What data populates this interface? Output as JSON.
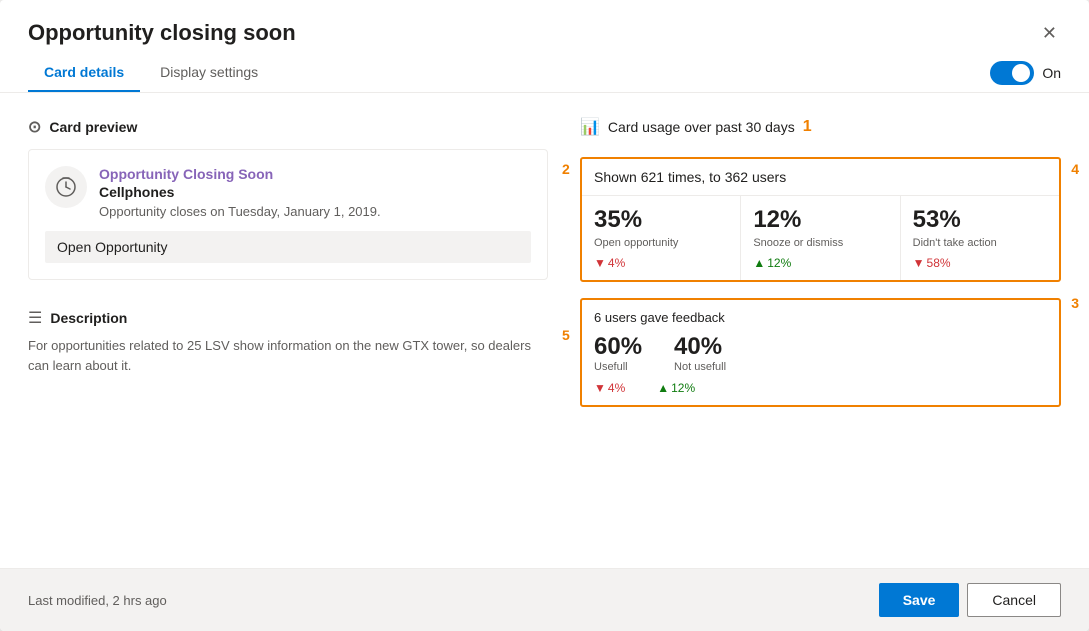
{
  "dialog": {
    "title": "Opportunity closing soon",
    "close_label": "✕"
  },
  "tabs": {
    "card_details": "Card details",
    "display_settings": "Display settings",
    "active": "card_details"
  },
  "toggle": {
    "label": "On",
    "checked": true
  },
  "card_preview": {
    "section_label": "Card preview",
    "card_title": "Opportunity Closing Soon",
    "card_subtitle": "Cellphones",
    "card_body": "Opportunity closes on Tuesday, January 1, 2019.",
    "action_button": "Open Opportunity"
  },
  "description": {
    "section_label": "Description",
    "text": "For opportunities related to 25 LSV show information on the new GTX tower, so dealers can learn about it."
  },
  "usage": {
    "section_label": "Card usage over past 30 days",
    "shown_text": "Shown 621 times, to 362 users",
    "stats": [
      {
        "pct": "35%",
        "label": "Open opportunity",
        "change_dir": "down",
        "change_val": "4%"
      },
      {
        "pct": "12%",
        "label": "Snooze or dismiss",
        "change_dir": "up",
        "change_val": "12%"
      },
      {
        "pct": "53%",
        "label": "Didn't take action",
        "change_dir": "down",
        "change_val": "58%"
      }
    ],
    "feedback": {
      "header": "6 users gave feedback",
      "items": [
        {
          "pct": "60%",
          "label": "Usefull",
          "change_dir": "down",
          "change_val": "4%"
        },
        {
          "pct": "40%",
          "label": "Not usefull",
          "change_dir": "up",
          "change_val": "12%"
        }
      ]
    },
    "annotations": [
      "1",
      "2",
      "3",
      "4",
      "5"
    ]
  },
  "footer": {
    "modified": "Last modified, 2 hrs ago",
    "save": "Save",
    "cancel": "Cancel"
  }
}
